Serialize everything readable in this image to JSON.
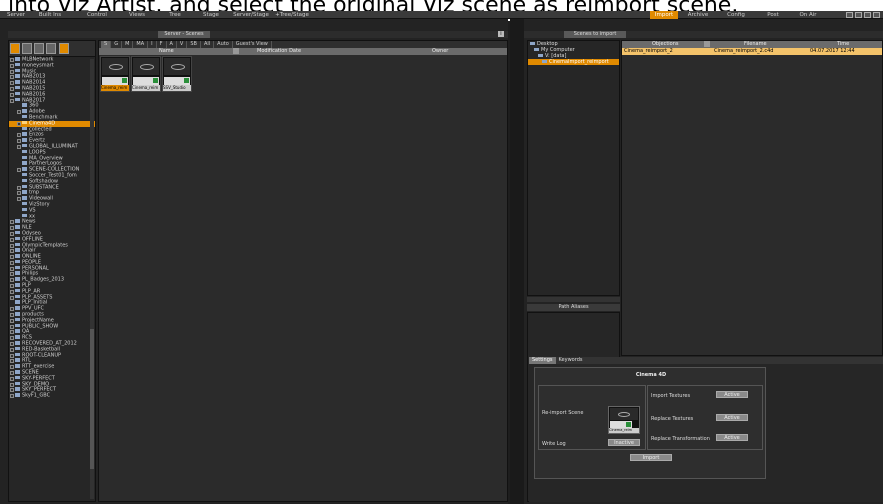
{
  "caption": "into Viz Artist, and select the original Viz scene as reimport scene.",
  "menubar": {
    "items": [
      "Server",
      "Built Ins",
      "Control",
      "Views",
      "Tree",
      "Stage",
      "Server/Stage",
      "+Tree/Stage"
    ],
    "right_items": [
      "Import",
      "Archive",
      "Config",
      "Post",
      "On Air"
    ],
    "selected": "Import"
  },
  "left_panel": {
    "tab_label": "Server - Scenes",
    "info_label": "i",
    "filters": [
      "S",
      "G",
      "M",
      "MA",
      "I",
      "F",
      "A",
      "V",
      "SB",
      "All",
      "Auto",
      "Guest's View"
    ],
    "selected_filter": "S",
    "columns": [
      "Name",
      "Modification Date",
      "Owner"
    ],
    "tree": [
      {
        "label": "MLBNetwork",
        "level": 0,
        "expand": true
      },
      {
        "label": "moneysmart",
        "level": 0,
        "expand": true
      },
      {
        "label": "Music",
        "level": 0,
        "expand": true
      },
      {
        "label": "NAB2013",
        "level": 0,
        "expand": true
      },
      {
        "label": "NAB2014",
        "level": 0,
        "expand": true
      },
      {
        "label": "NAB2015",
        "level": 0,
        "expand": true
      },
      {
        "label": "NAB2016",
        "level": 0,
        "expand": true
      },
      {
        "label": "NAB2017",
        "level": 0,
        "expand": true
      },
      {
        "label": "360",
        "level": 1,
        "expand": false
      },
      {
        "label": "Adobe",
        "level": 1,
        "expand": true
      },
      {
        "label": "Benchmark",
        "level": 1,
        "expand": false
      },
      {
        "label": "Cinema4D",
        "level": 1,
        "expand": true,
        "selected": true
      },
      {
        "label": "collected",
        "level": 1,
        "expand": false
      },
      {
        "label": "Enzos",
        "level": 1,
        "expand": true
      },
      {
        "label": "Evertz",
        "level": 1,
        "expand": true
      },
      {
        "label": "GLOBAL_ILLUMINAT",
        "level": 1,
        "expand": true
      },
      {
        "label": "LOOPS",
        "level": 1,
        "expand": false
      },
      {
        "label": "MA_Overview",
        "level": 1,
        "expand": false
      },
      {
        "label": "PartnerLogos",
        "level": 1,
        "expand": false
      },
      {
        "label": "SCENE-COLLECTION",
        "level": 1,
        "expand": true
      },
      {
        "label": "Soccer_Test01_fom",
        "level": 1,
        "expand": false
      },
      {
        "label": "Softshadow",
        "level": 1,
        "expand": false
      },
      {
        "label": "SUBSTANCE",
        "level": 1,
        "expand": true
      },
      {
        "label": "tmp",
        "level": 1,
        "expand": true
      },
      {
        "label": "Videowall",
        "level": 1,
        "expand": true
      },
      {
        "label": "VizStory",
        "level": 1,
        "expand": false
      },
      {
        "label": "VS",
        "level": 1,
        "expand": false
      },
      {
        "label": "xx",
        "level": 1,
        "expand": false
      },
      {
        "label": "News",
        "level": 0,
        "expand": true
      },
      {
        "label": "NLE",
        "level": 0,
        "expand": true
      },
      {
        "label": "Odyseo",
        "level": 0,
        "expand": true
      },
      {
        "label": "OFFLINE",
        "level": 0,
        "expand": true
      },
      {
        "label": "OlympicTemplates",
        "level": 0,
        "expand": true
      },
      {
        "label": "Onair",
        "level": 0,
        "expand": true
      },
      {
        "label": "ONLINE",
        "level": 0,
        "expand": true
      },
      {
        "label": "PEOPLE",
        "level": 0,
        "expand": true
      },
      {
        "label": "PERSONAL",
        "level": 0,
        "expand": true
      },
      {
        "label": "Philips",
        "level": 0,
        "expand": true
      },
      {
        "label": "PL_Badges_2013",
        "level": 0,
        "expand": true
      },
      {
        "label": "PLP",
        "level": 0,
        "expand": true
      },
      {
        "label": "PLP_AR",
        "level": 0,
        "expand": true
      },
      {
        "label": "PLP_ASSETS",
        "level": 0,
        "expand": true
      },
      {
        "label": "PLP_Initial",
        "level": 0,
        "expand": false
      },
      {
        "label": "PPV_UFC",
        "level": 0,
        "expand": true
      },
      {
        "label": "products",
        "level": 0,
        "expand": true
      },
      {
        "label": "ProjectName",
        "level": 0,
        "expand": true
      },
      {
        "label": "PUBLIC_SHOW",
        "level": 0,
        "expand": true
      },
      {
        "label": "QA",
        "level": 0,
        "expand": true
      },
      {
        "label": "RCS",
        "level": 0,
        "expand": true
      },
      {
        "label": "RECOVERED_AT_2012",
        "level": 0,
        "expand": true
      },
      {
        "label": "RED-Basketball",
        "level": 0,
        "expand": true
      },
      {
        "label": "ROOT-CLEANUP",
        "level": 0,
        "expand": true
      },
      {
        "label": "RTL",
        "level": 0,
        "expand": true
      },
      {
        "label": "RTT_exercise",
        "level": 0,
        "expand": true
      },
      {
        "label": "SCENE",
        "level": 0,
        "expand": true
      },
      {
        "label": "SKY-PERFECT",
        "level": 0,
        "expand": true
      },
      {
        "label": "SKY_DEMO",
        "level": 0,
        "expand": true
      },
      {
        "label": "SKY_PERFECT",
        "level": 0,
        "expand": true
      },
      {
        "label": "SkyF1_GBC",
        "level": 0,
        "expand": true
      }
    ],
    "thumbnails": [
      {
        "label": "Cinema_reim",
        "selected": true
      },
      {
        "label": "Cinema_reim"
      },
      {
        "label": "SSV_Studio"
      }
    ]
  },
  "right_panel": {
    "tab_label": "Scenes to import",
    "tree": [
      {
        "label": "Desktop",
        "level": 0
      },
      {
        "label": "My Computer",
        "level": 1
      },
      {
        "label": "V: [data]",
        "level": 2
      },
      {
        "label": "CinemaImport_reimport",
        "level": 3,
        "selected": true
      }
    ],
    "path_aliases": "Path Aliases",
    "columns": [
      "Objections",
      "Filename",
      "Time"
    ],
    "rows": [
      {
        "objection": "Cinema_reimport_2",
        "filename": "Cinema_reimport_2.c4d",
        "time": "04.07.2017 12:44"
      }
    ],
    "settings": {
      "tabs": [
        "Settings",
        "Keywords"
      ],
      "selected_tab": "Settings",
      "title": "Cinema 4D",
      "reimport_label": "Re-import Scene",
      "reimport_thumb_label": "Cinema_reim",
      "write_log_label": "Write Log",
      "write_log_value": "Inactive",
      "import_textures_label": "Import Textures",
      "import_textures_value": "Active",
      "replace_textures_label": "Replace Textures",
      "replace_textures_value": "Active",
      "replace_transform_label": "Replace Transformation",
      "replace_transform_value": "Active",
      "import_button": "Import"
    }
  },
  "colors": {
    "accent": "#e08a00",
    "row_highlight": "#f4c36a",
    "folder": "#8fa6c8"
  }
}
